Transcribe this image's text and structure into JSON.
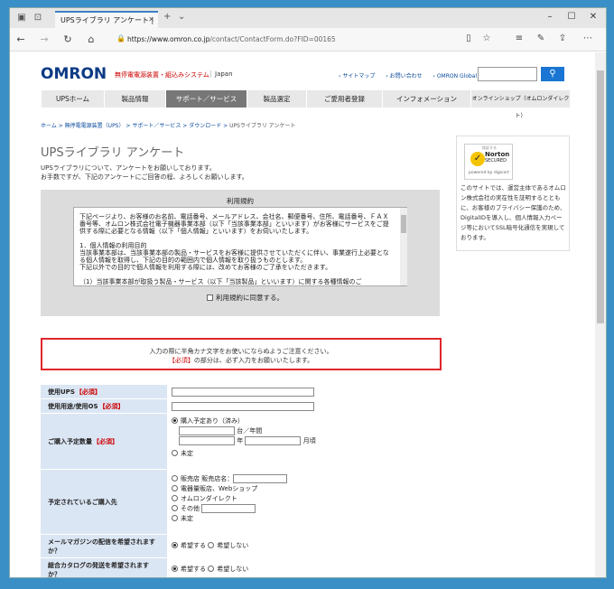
{
  "browser": {
    "tab_title": "UPSライブラリ アンケート | ",
    "url_host": "https://www.omron.co.jp",
    "url_path": "/contact/ContactForm.do?FID=00165"
  },
  "header": {
    "logo": "OMRON",
    "tagline": "無停電電源装置・組込みシステム",
    "region": "Japan",
    "links": [
      "サイトマップ",
      "お問い合わせ",
      "OMRON Global"
    ],
    "search_button": "Q"
  },
  "gnav": [
    {
      "label": "UPSホーム",
      "w": 70
    },
    {
      "label": "製品情報",
      "w": 68
    },
    {
      "label": "サポート／サービス",
      "w": 90
    },
    {
      "label": "製品選定",
      "w": 66
    },
    {
      "label": "ご愛用者登録",
      "w": 84
    },
    {
      "label": "インフォメーション",
      "w": 98
    },
    {
      "label": "オンラインショップ（オムロンダイレクト）",
      "w": 110
    }
  ],
  "breadcrumb": [
    "ホーム",
    "無停電電源装置（UPS）",
    "サポート／サービス",
    "ダウンロード"
  ],
  "breadcrumb_current": "UPSライブラリ アンケート",
  "page_title": "UPSライブラリ アンケート",
  "intro_line1": "UPSライブラリについて、アンケートをお願いしております。",
  "intro_line2": "お手数ですが、下記のアンケートにご回答の程、よろしくお願いします。",
  "terms": {
    "title": "利用規約",
    "text": "下記ページより、お客様のお名前、電話番号、メールアドレス、会社名、郵便番号、住所、電話番号、ＦＡＸ番号等、オムロン株式会社電子機器事業本部（以下「当該事業本部」といいます）がお客様にサービスをご提供する際に必要となる情報（以下「個人情報」といいます）をお伺いいたします。\n\n1．個人情報の利用目的\n当該事業本部は、当該事業本部の製品・サービスをお客様に提供させていただくに伴い、事業遂行上必要となる個人情報を取得し、下記の目的の範囲内で個人情報を取り扱うものとします。\n下記以外での目的で個人情報を利用する際には、改めてお客様のご了承をいただきます。\n\n（1）当該事業本部が取扱う製品・サービス（以下「当該製品」といいます）に関する各種情報のご",
    "agree_label": "利用規約に同意する。"
  },
  "notice": {
    "line1": "入力の際に半角カナ文字をお使いにならぬようご注意ください。",
    "required_mark": "【必須】",
    "line2_rest": "の部分は、必ず入力をお願いいたします。"
  },
  "form": {
    "required": "【必須】",
    "ups_label": "使用UPS",
    "os_label": "使用用途/使用OS",
    "qty_label": "ご購入予定数量",
    "qty_plan": "購入予定あり（済み）",
    "qty_unit1": "台／年間",
    "qty_year": "年",
    "qty_month": "月頃",
    "qty_none": "未定",
    "shop_label": "予定されているご購入先",
    "shop_options": [
      "販売店",
      "電器量販店、Webショップ",
      "オムロンダイレクト",
      "その他",
      "未定"
    ],
    "shop_name": "販売店名：",
    "mail_label": "メールマガジンの配信を希望されますか？",
    "catalog_label": "総合カタログの発送を希望されますか？",
    "yes": "希望する",
    "no": "希望しない"
  },
  "sidebar": {
    "norton_top": "保証する",
    "norton_brand": "Norton",
    "norton_secured": "SECURED",
    "norton_by": "powered by digicert",
    "text": "このサイトでは、運営主体であるオムロン株式会社の実在性を証明するとともに、お客様のプライバシー保護のため、DigitalIDを導入し、個人情報入力ページ等においてSSL暗号化通信を実現しております。"
  }
}
